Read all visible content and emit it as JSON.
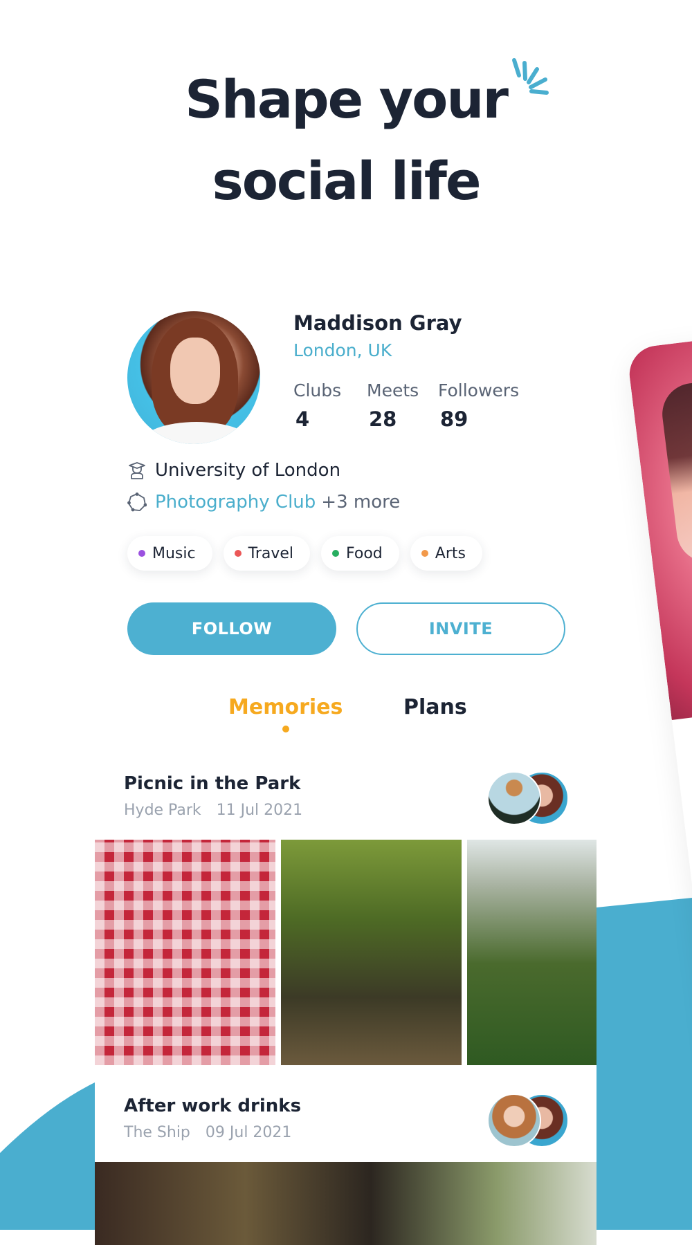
{
  "headline": {
    "line1": "Shape your",
    "line2": "social life"
  },
  "profile": {
    "name": "Maddison Gray",
    "location": "London, UK",
    "stats": [
      {
        "label": "Clubs",
        "value": "4"
      },
      {
        "label": "Meets",
        "value": "28"
      },
      {
        "label": "Followers",
        "value": "89"
      }
    ],
    "university": "University of London",
    "club": "Photography Club",
    "club_more": "+3 more",
    "interests": [
      {
        "label": "Music",
        "color": "#9b51e0"
      },
      {
        "label": "Travel",
        "color": "#eb5757"
      },
      {
        "label": "Food",
        "color": "#27ae60"
      },
      {
        "label": "Arts",
        "color": "#f2994a"
      }
    ]
  },
  "actions": {
    "follow": "FOLLOW",
    "invite": "INVITE"
  },
  "tabs": {
    "memories": "Memories",
    "plans": "Plans",
    "active": "Memories"
  },
  "events": [
    {
      "title": "Picnic in the Park",
      "place": "Hyde Park",
      "date": "11 Jul 2021"
    },
    {
      "title": "After work drinks",
      "place": "The Ship",
      "date": "09 Jul 2021"
    }
  ],
  "colors": {
    "accent": "#4db0d1",
    "active_tab": "#f6a91f",
    "text": "#1c2434"
  }
}
